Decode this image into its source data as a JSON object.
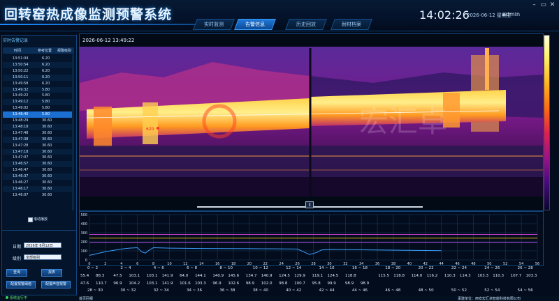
{
  "header": {
    "title": "回转窑热成像监测预警系统",
    "tabs": [
      "实时监测",
      "告警信息",
      "历史回放",
      "耐材档案"
    ],
    "active_tab": 1,
    "clock": "14:02:26",
    "date": "2026-06-12 星期五",
    "user": "admin",
    "controls": [
      "–",
      "▭",
      "✕"
    ]
  },
  "alarm_panel": {
    "title": "实时告警记录",
    "columns": [
      "时间",
      "参考位置",
      "报警级别"
    ],
    "rows": [
      [
        "13:51:04",
        "6.20"
      ],
      [
        "13:50:54",
        "6.20"
      ],
      [
        "13:50:22",
        "6.20"
      ],
      [
        "13:50:11",
        "6.20"
      ],
      [
        "13:49:58",
        "6.20"
      ],
      [
        "13:49:32",
        "5.80"
      ],
      [
        "13:49:22",
        "5.80"
      ],
      [
        "13:49:12",
        "5.80"
      ],
      [
        "13:49:02",
        "5.80"
      ],
      [
        "13:48:40",
        "5.80"
      ],
      [
        "13:48:29",
        "30.60"
      ],
      [
        "13:48:18",
        "30.60"
      ],
      [
        "13:47:48",
        "30.60"
      ],
      [
        "13:47:38",
        "30.60"
      ],
      [
        "13:47:28",
        "30.60"
      ],
      [
        "13:47:18",
        "30.60"
      ],
      [
        "13:47:07",
        "30.60"
      ],
      [
        "13:46:57",
        "30.60"
      ],
      [
        "13:46:47",
        "30.60"
      ],
      [
        "13:46:37",
        "30.60"
      ],
      [
        "13:46:27",
        "30.60"
      ],
      [
        "13:46:17",
        "30.60"
      ],
      [
        "13:46:07",
        "30.60"
      ]
    ],
    "selected_row": 9,
    "autoscroll_label": "滚动播放"
  },
  "filter": {
    "date_label": "日期",
    "date_value": "2026年 6月12日",
    "level_label": "级别",
    "level_value": "全部级别",
    "buttons": [
      "查询",
      "报表",
      "配置报警阈值",
      "配置声音报警"
    ]
  },
  "status": "系统运行中",
  "thermal": {
    "timestamp": "2026-06-12 13:49:22",
    "hotspot_label": "620",
    "watermark": "宏汇卓",
    "pager_symbol": "||"
  },
  "chart_data": {
    "type": "line",
    "x": [
      0,
      2,
      4,
      5,
      6,
      6.5,
      7,
      7.5,
      8,
      10,
      14,
      20,
      26,
      27,
      27.5,
      28,
      28.5,
      29,
      30,
      34,
      38,
      42,
      44
    ],
    "y": [
      50,
      90,
      120,
      130,
      135,
      90,
      75,
      110,
      135,
      130,
      126,
      124,
      120,
      80,
      60,
      70,
      85,
      110,
      115,
      112,
      108,
      104,
      102
    ],
    "xlim": [
      0,
      56
    ],
    "ylim": [
      0,
      500
    ],
    "xticks": [
      0,
      2,
      4,
      6,
      8,
      10,
      12,
      14,
      16,
      18,
      20,
      22,
      24,
      26,
      28,
      30,
      32,
      34,
      36,
      38,
      40,
      42,
      44,
      46,
      48,
      50,
      52,
      54,
      56
    ],
    "yticks": [
      0,
      100,
      200,
      300,
      400,
      500
    ],
    "thresholds": [
      {
        "value": 280,
        "color": "#e040e0"
      },
      {
        "value": 240,
        "color": "#f0c020"
      },
      {
        "value": 190,
        "color": "#c050f0"
      }
    ],
    "line_color": "#3aa0ff",
    "grid": true
  },
  "data_table": {
    "segments": [
      "0 ~ 2",
      "2 ~ 4",
      "4 ~ 6",
      "6 ~ 8",
      "8 ~ 10",
      "10 ~ 12",
      "12 ~ 14",
      "14 ~ 16",
      "16 ~ 18",
      "18 ~ 20",
      "20 ~ 22",
      "22 ~ 24",
      "24 ~ 26",
      "26 ~ 28"
    ],
    "max_row": [
      "55.4",
      "88.3",
      "47.5",
      "103.1",
      "103.1",
      "141.9",
      "64.0",
      "144.1",
      "140.9",
      "145.6",
      "134.7",
      "140.9",
      "124.5",
      "129.9",
      "119.1",
      "124.5",
      "118.8",
      "",
      "115.5",
      "118.8",
      "114.0",
      "116.2",
      "110.3",
      "114.3",
      "103.3",
      "110.3",
      "107.7",
      "103.3"
    ],
    "avg_row": [
      "47.6",
      "110.7",
      "96.9",
      "104.2",
      "103.1",
      "141.9",
      "101.6",
      "103.3",
      "96.9",
      "102.6",
      "98.9",
      "102.0",
      "98.8",
      "100.7",
      "95.8",
      "99.9",
      "98.9",
      "98.9",
      "",
      "",
      "",
      "",
      "",
      "",
      "",
      "",
      "",
      ""
    ],
    "segments2": [
      "28 ~ 30",
      "30 ~ 32",
      "32 ~ 34",
      "34 ~ 36",
      "36 ~ 38",
      "38 ~ 40",
      "40 ~ 42",
      "42 ~ 44",
      "44 ~ 46",
      "46 ~ 48",
      "48 ~ 50",
      "50 ~ 52",
      "52 ~ 54",
      "54 ~ 56"
    ]
  },
  "footer": {
    "page_label": "首页回报",
    "company": "承建单位：西安宏汇卓智能科技有限公司"
  }
}
